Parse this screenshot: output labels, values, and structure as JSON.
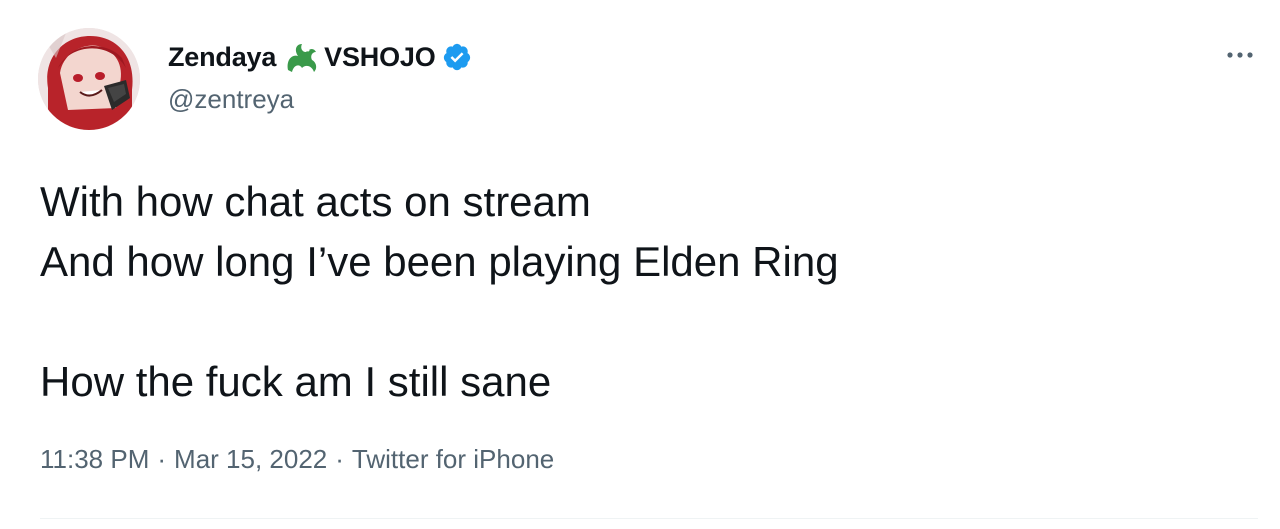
{
  "tweet": {
    "author": {
      "display_name": "Zendaya",
      "affiliation": "VSHOJO",
      "handle": "@zentreya"
    },
    "text_lines": [
      "With how chat acts on stream",
      "And how long I’ve been playing Elden Ring",
      "",
      "How the fuck am I still sane"
    ],
    "meta": {
      "time": "11:38 PM",
      "separator": "·",
      "date": "Mar 15, 2022",
      "source": "Twitter for iPhone"
    },
    "icons": {
      "affiliation_badge": "dragon-icon",
      "verified_badge": "verified-icon",
      "more_menu": "more-options-icon"
    },
    "colors": {
      "verified": "#1d9bf0",
      "dragon": "#3a9a4a",
      "secondary_text": "#536471",
      "primary_text": "#0f1419"
    }
  }
}
